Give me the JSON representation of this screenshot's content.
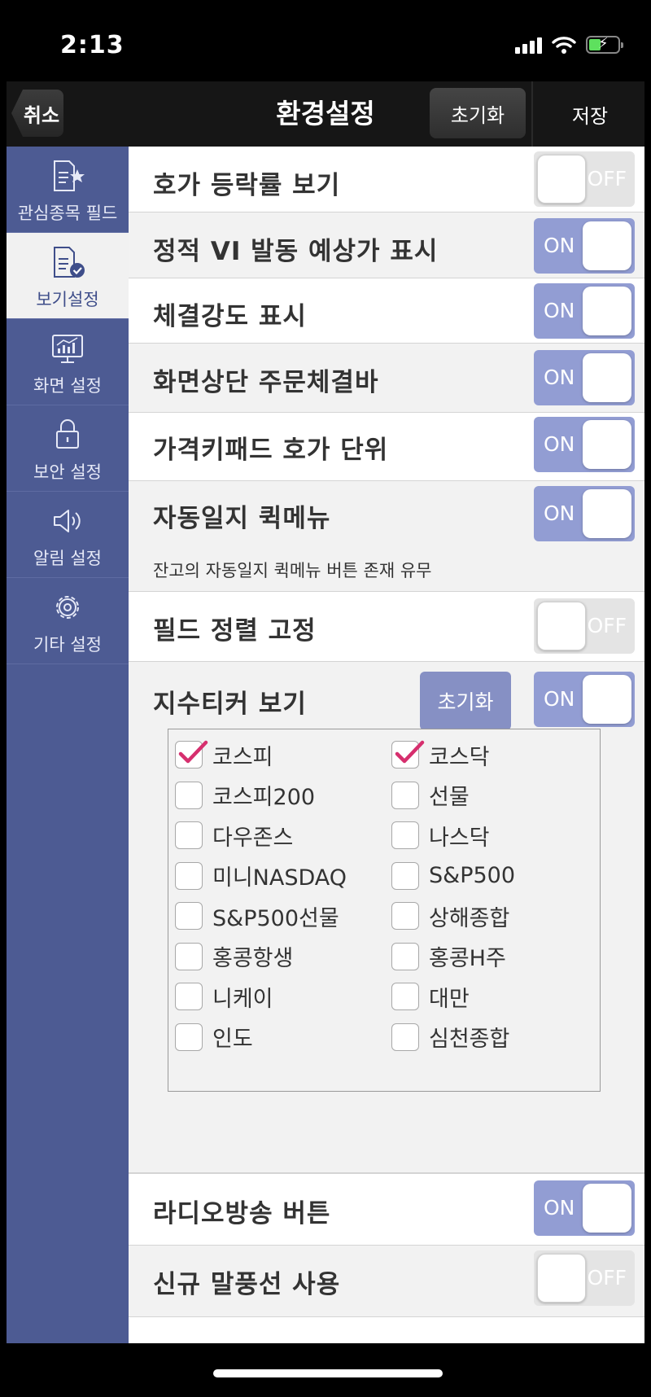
{
  "status_bar": {
    "time": "2:13"
  },
  "header": {
    "cancel_label": "취소",
    "title": "환경설정",
    "reset_label": "초기화",
    "save_label": "저장"
  },
  "sidebar": {
    "items": [
      {
        "label": "관심종목 필드",
        "icon": "document-star-icon"
      },
      {
        "label": "보기설정",
        "icon": "document-check-icon",
        "active": true
      },
      {
        "label": "화면 설정",
        "icon": "monitor-chart-icon"
      },
      {
        "label": "보안 설정",
        "icon": "lock-icon"
      },
      {
        "label": "알림 설정",
        "icon": "speaker-icon"
      },
      {
        "label": "기타 설정",
        "icon": "gear-icon"
      }
    ]
  },
  "settings": [
    {
      "label": "호가 등락률 보기",
      "toggle": "OFF"
    },
    {
      "label": "정적 VI 발동 예상가 표시",
      "toggle": "ON"
    },
    {
      "label": "체결강도 표시",
      "toggle": "ON"
    },
    {
      "label": "화면상단 주문체결바",
      "toggle": "ON"
    },
    {
      "label": "가격키패드 호가 단위",
      "toggle": "ON"
    },
    {
      "label": "자동일지 퀵메뉴",
      "toggle": "ON",
      "description": "잔고의 자동일지 퀵메뉴 버튼 존재 유무"
    },
    {
      "label": "필드 정렬 고정",
      "toggle": "OFF"
    },
    {
      "label": "지수티커 보기",
      "toggle": "ON",
      "reset_label": "초기화"
    },
    {
      "label": "라디오방송 버튼",
      "toggle": "ON"
    },
    {
      "label": "신규 말풍선 사용",
      "toggle": "OFF"
    }
  ],
  "tickers": {
    "left": [
      {
        "label": "코스피",
        "checked": true
      },
      {
        "label": "코스피200",
        "checked": false
      },
      {
        "label": "다우존스",
        "checked": false
      },
      {
        "label": "미니NASDAQ",
        "checked": false
      },
      {
        "label": "S&P500선물",
        "checked": false
      },
      {
        "label": "홍콩항생",
        "checked": false
      },
      {
        "label": "니케이",
        "checked": false
      },
      {
        "label": "인도",
        "checked": false
      }
    ],
    "right": [
      {
        "label": "코스닥",
        "checked": true
      },
      {
        "label": "선물",
        "checked": false
      },
      {
        "label": "나스닥",
        "checked": false
      },
      {
        "label": "S&P500",
        "checked": false
      },
      {
        "label": "상해종합",
        "checked": false
      },
      {
        "label": "홍콩H주",
        "checked": false
      },
      {
        "label": "대만",
        "checked": false
      },
      {
        "label": "심천종합",
        "checked": false
      }
    ]
  },
  "colors": {
    "sidebar": "#4d5b93",
    "toggle_on": "#929dd3",
    "toggle_off": "#e4e4e4",
    "check_mark": "#d62f6e"
  }
}
